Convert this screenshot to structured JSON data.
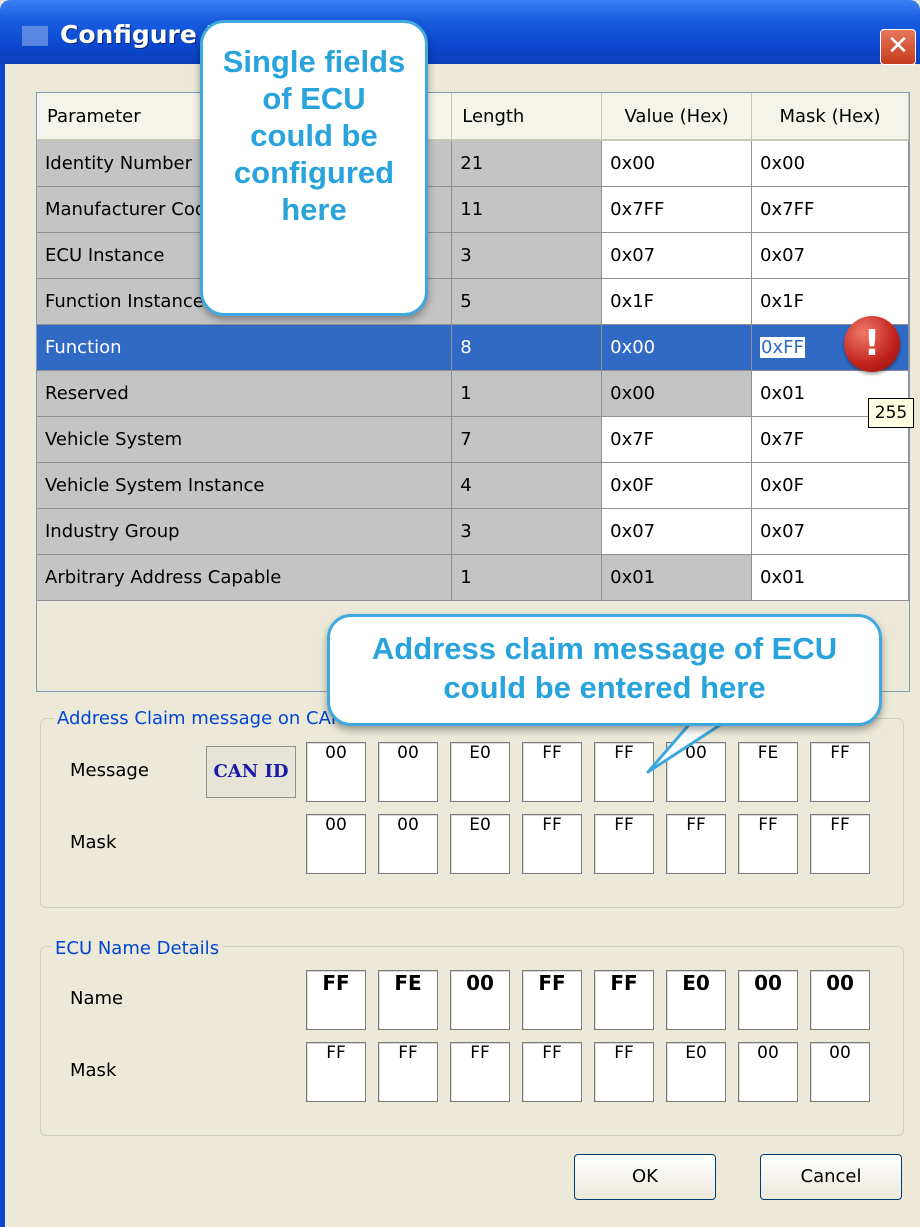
{
  "window": {
    "title": "Configure ECU",
    "close_label": "✕"
  },
  "table": {
    "headers": [
      "Parameter",
      "Length",
      "Value (Hex)",
      "Mask (Hex)"
    ],
    "rows": [
      {
        "param": "Identity Number",
        "length": "21",
        "value": "0x00",
        "mask": "0x00"
      },
      {
        "param": "Manufacturer Code",
        "length": "11",
        "value": "0x7FF",
        "mask": "0x7FF"
      },
      {
        "param": "ECU Instance",
        "length": "3",
        "value": "0x07",
        "mask": "0x07"
      },
      {
        "param": "Function Instance",
        "length": "5",
        "value": "0x1F",
        "mask": "0x1F"
      },
      {
        "param": "Function",
        "length": "8",
        "value": "0x00",
        "mask": "0xFF"
      },
      {
        "param": "Reserved",
        "length": "1",
        "value": "0x00",
        "mask": "0x01"
      },
      {
        "param": "Vehicle System",
        "length": "7",
        "value": "0x7F",
        "mask": "0x7F"
      },
      {
        "param": "Vehicle System Instance",
        "length": "4",
        "value": "0x0F",
        "mask": "0x0F"
      },
      {
        "param": "Industry Group",
        "length": "3",
        "value": "0x07",
        "mask": "0x07"
      },
      {
        "param": "Arbitrary Address Capable",
        "length": "1",
        "value": "0x01",
        "mask": "0x01"
      }
    ]
  },
  "address_claim": {
    "legend": "Address Claim message on CAN",
    "message_label": "Message",
    "can_id_label": "CAN ID",
    "mask_label": "Mask",
    "message_bytes": [
      "00",
      "00",
      "E0",
      "FF",
      "FF",
      "00",
      "FE",
      "FF"
    ],
    "mask_bytes": [
      "00",
      "00",
      "E0",
      "FF",
      "FF",
      "FF",
      "FF",
      "FF"
    ]
  },
  "ecu_name": {
    "legend": "ECU Name Details",
    "name_label": "Name",
    "mask_label": "Mask",
    "name_bytes": [
      "FF",
      "FE",
      "00",
      "FF",
      "FF",
      "E0",
      "00",
      "00"
    ],
    "mask_bytes": [
      "FF",
      "FF",
      "FF",
      "FF",
      "FF",
      "E0",
      "00",
      "00"
    ]
  },
  "buttons": {
    "ok": "OK",
    "cancel": "Cancel"
  },
  "callouts": {
    "fields": "Single fields of ECU could be configured here",
    "address": "Address claim message of ECU could be entered here"
  },
  "error": {
    "icon": "exclamation-icon",
    "symbol": "!",
    "tooltip": "255"
  },
  "colors": {
    "selection": "#316ac5",
    "callout_text": "#29a3dc",
    "titlebar": "#0a48d0"
  }
}
